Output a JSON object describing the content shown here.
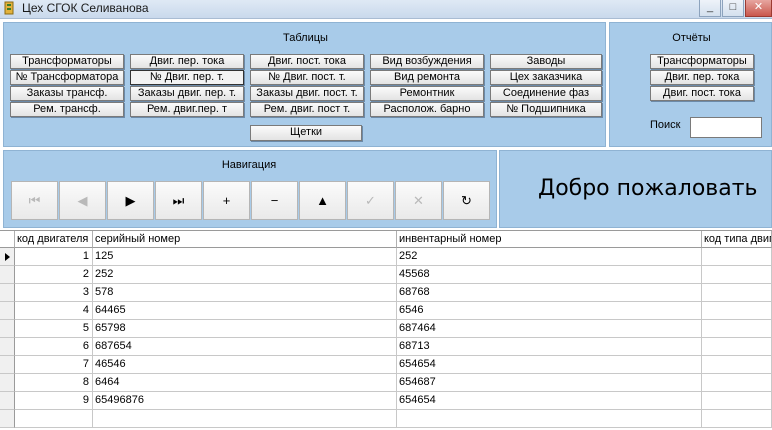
{
  "window": {
    "title": "Цех СГОК Селиванова"
  },
  "tables_panel": {
    "title": "Таблицы",
    "buttons": [
      "Трансформаторы",
      "№ Трансформатора",
      "Заказы трансф.",
      "Рем. трансф.",
      "Двиг. пер. тока",
      "№ Двиг. пер. т.",
      "Заказы двиг. пер. т.",
      "Рем. двиг.пер. т",
      "Двиг. пост. тока",
      "№ Двиг. пост. т.",
      "Заказы двиг. пост. т.",
      "Рем. двиг. пост т.",
      "Вид возбуждения",
      "Вид ремонта",
      "Ремонтник",
      "Располож. барно",
      "Заводы",
      "Цех заказчика",
      "Соединение фаз",
      "№ Подшипника",
      "Щетки"
    ]
  },
  "reports_panel": {
    "title": "Отчёты",
    "buttons": [
      "Трансформаторы",
      "Двиг. пер. тока",
      "Двиг. пост. тока"
    ],
    "search_label": "Поиск",
    "search_value": ""
  },
  "navigation_panel": {
    "title": "Навигация",
    "buttons": [
      {
        "icon": "first-record-icon",
        "glyph": "⏮",
        "enabled": false
      },
      {
        "icon": "prev-record-icon",
        "glyph": "◀",
        "enabled": false
      },
      {
        "icon": "next-record-icon",
        "glyph": "▶",
        "enabled": true
      },
      {
        "icon": "last-record-icon",
        "glyph": "⏭",
        "enabled": true
      },
      {
        "icon": "insert-icon",
        "glyph": "+",
        "enabled": true
      },
      {
        "icon": "delete-icon",
        "glyph": "−",
        "enabled": true
      },
      {
        "icon": "edit-icon",
        "glyph": "▲",
        "enabled": true
      },
      {
        "icon": "post-icon",
        "glyph": "✓",
        "enabled": false
      },
      {
        "icon": "cancel-icon",
        "glyph": "✕",
        "enabled": false
      },
      {
        "icon": "refresh-icon",
        "glyph": "↻",
        "enabled": true
      }
    ]
  },
  "welcome_text": "Добро пожаловать",
  "grid": {
    "columns": [
      "код двигателя",
      "серийный номер",
      "инвентарный номер",
      "код типа двиг"
    ],
    "rows": [
      [
        "1",
        "125",
        "252"
      ],
      [
        "2",
        "252",
        "45568"
      ],
      [
        "3",
        "578",
        "68768"
      ],
      [
        "4",
        "64465",
        "6546"
      ],
      [
        "5",
        "65798",
        "687464"
      ],
      [
        "6",
        "687654",
        "68713"
      ],
      [
        "7",
        "46546",
        "654654"
      ],
      [
        "8",
        "6464",
        "654687"
      ],
      [
        "9",
        "65496876",
        "654654"
      ]
    ]
  },
  "colors": {
    "panel_bg": "#a8cbe9",
    "window_bg": "#ffffff"
  }
}
